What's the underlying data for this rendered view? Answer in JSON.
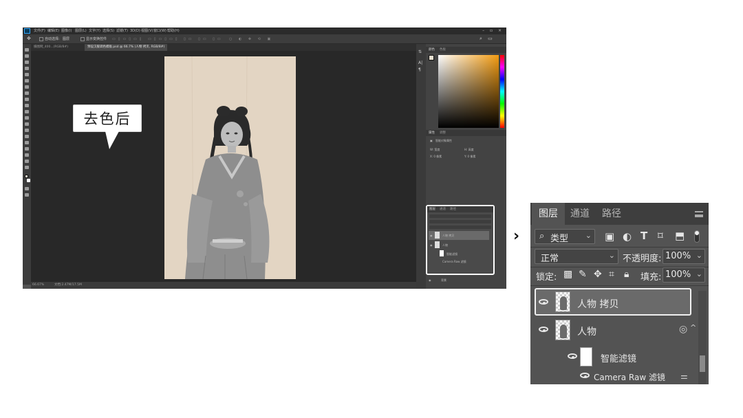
{
  "photoshop": {
    "menu": [
      "文件(F)",
      "编辑(E)",
      "图像(I)",
      "图层(L)",
      "文字(Y)",
      "选择(S)",
      "滤镜(T)",
      "3D(D)",
      "视图(V)",
      "窗口(W)",
      "帮助(H)"
    ],
    "window_controls": "–  ▫  ×",
    "options": {
      "auto_select": "自动选择:",
      "auto_select_value": "图层",
      "show_transform": "显示变换控件"
    },
    "tabs": [
      "摄图网_400...(RGB/8#)",
      "预设汉服调色模板.psd @ 66.7% (人物 拷贝, RGB/8#)"
    ],
    "status": {
      "zoom": "66.67%",
      "doc": "文档:2.47M/17.5M"
    },
    "panels": {
      "color_tabs": [
        "颜色",
        "色板"
      ],
      "props_tabs": [
        "属性",
        "调整"
      ],
      "props_title": "智能对象属性",
      "props_rows": [
        "W: 宽度",
        "H: 高度",
        "X: 0 像素",
        "Y: 0 像素"
      ],
      "layers_tabs": [
        "图层",
        "通道",
        "路径"
      ],
      "mini_layers": [
        "人物 拷贝",
        "人物",
        "智能滤镜",
        "Camera Raw 滤镜",
        "背景"
      ]
    }
  },
  "callout": {
    "text": "去色后"
  },
  "arrow": "›",
  "zoomed_layers_panel": {
    "tabs": [
      "图层",
      "通道",
      "路径"
    ],
    "filter_kind": "类型",
    "blend_mode": "正常",
    "opacity_label": "不透明度:",
    "opacity_value": "100%",
    "lock_label": "锁定:",
    "fill_label": "填充:",
    "fill_value": "100%",
    "layers": [
      {
        "name": "人物 拷贝",
        "visible": true,
        "selected": true
      },
      {
        "name": "人物",
        "visible": true,
        "selected": false
      },
      {
        "name": "智能滤镜",
        "visible": true,
        "selected": false
      },
      {
        "name": "Camera Raw 滤镜",
        "visible": true,
        "selected": false
      }
    ]
  }
}
